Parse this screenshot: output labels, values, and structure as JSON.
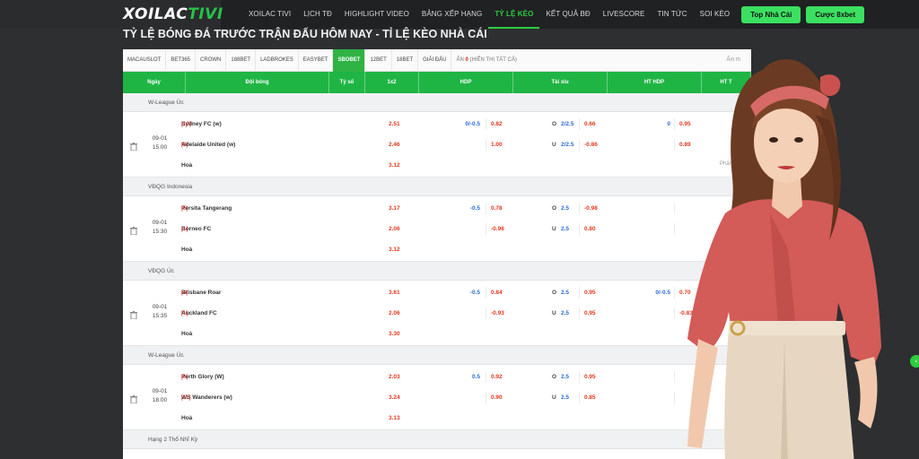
{
  "logo": {
    "part1": "XOILAC",
    "part2": "TIVI"
  },
  "nav": [
    "XOILAC TIVI",
    "LỊCH TĐ",
    "HIGHLIGHT VIDEO",
    "BẢNG XẾP HẠNG",
    "TỶ LỆ KÈO",
    "KẾT QUẢ BĐ",
    "LIVESCORE",
    "TIN TỨC",
    "SOI KÈO"
  ],
  "nav_active_index": 4,
  "cta": {
    "top": "Top Nhà Cái",
    "bet": "Cược 8xbet"
  },
  "page_title": "TỶ LỆ BÓNG ĐÁ TRƯỚC TRẬN ĐẤU HÔM NAY - TỈ LỆ KÈO NHÀ CÁI",
  "bookmakers": [
    "MACAUSLOT",
    "BET365",
    "CROWN",
    "188BET",
    "LADBROKES",
    "EASYBET",
    "SBOBET",
    "12BET",
    "18BET",
    "GIẢI ĐẤU"
  ],
  "bookmaker_active_index": 6,
  "hide": {
    "label": "ẨN",
    "count": "0",
    "show_all": "(HIỂN THỊ TẤT CẢ)",
    "right": "Ẩm th"
  },
  "columns": [
    "Ngày",
    "Đội bóng",
    "Tỷ số",
    "1x2",
    "HDP",
    "Tài xỉu",
    "HT HDP",
    "HT T"
  ],
  "more": "Phân tíc",
  "groups": [
    {
      "league": "W-League Úc",
      "date": "09-01",
      "time": "15:00",
      "home": "Sydney FC (w)",
      "home_rank": "[10]",
      "away": "Adelaide United (w)",
      "away_rank": "[8]",
      "draw": "Hoà",
      "x12": [
        "2.51",
        "2.46",
        "3.12"
      ],
      "hdp_line": [
        "0/-0.5",
        ""
      ],
      "hdp_odds": [
        "0.82",
        "1.00"
      ],
      "ou_side": [
        "O",
        "U"
      ],
      "ou_line": [
        "2/2.5",
        "2/2.5"
      ],
      "ou_odds": [
        "0.66",
        "-0.86"
      ],
      "ht_line": [
        "0",
        ""
      ],
      "ht_odds": [
        "0.95",
        "0.89"
      ],
      "show_more": true
    },
    {
      "league": "VĐQG Indonesia",
      "date": "09-01",
      "time": "15:30",
      "home": "Persita Tangerang",
      "home_rank": "[5]",
      "away": "Borneo FC",
      "away_rank": "[1]",
      "draw": "Hoà",
      "x12": [
        "3.17",
        "2.06",
        "3.12"
      ],
      "hdp_line": [
        "-0.5",
        ""
      ],
      "hdp_odds": [
        "0.78",
        "-0.96"
      ],
      "ou_side": [
        "O",
        "U"
      ],
      "ou_line": [
        "2.5",
        "2.5"
      ],
      "ou_odds": [
        "-0.98",
        "0.80"
      ],
      "ht_line": [
        "",
        ""
      ],
      "ht_odds": [
        "",
        ""
      ],
      "show_more": false
    },
    {
      "league": "VĐQG Úc",
      "date": "09-01",
      "time": "15:35",
      "home": "Brisbane Roar",
      "home_rank": "[4]",
      "away": "Auckland FC",
      "away_rank": "[1]",
      "draw": "Hoà",
      "x12": [
        "3.61",
        "2.06",
        "3.30"
      ],
      "hdp_line": [
        "-0.5",
        ""
      ],
      "hdp_odds": [
        "0.84",
        "-0.93"
      ],
      "ou_side": [
        "O",
        "U"
      ],
      "ou_line": [
        "2.5",
        "2.5"
      ],
      "ou_odds": [
        "0.95",
        "0.95"
      ],
      "ht_line": [
        "0/-0.5",
        ""
      ],
      "ht_odds": [
        "0.70",
        "-0.83"
      ],
      "show_more": false
    },
    {
      "league": "W-League Úc",
      "date": "09-01",
      "time": "18:00",
      "home": "Perth Glory (W)",
      "home_rank": "[6]",
      "away": "WS Wanderers (w)",
      "away_rank": "[11]",
      "draw": "Hoà",
      "x12": [
        "2.03",
        "3.24",
        "3.13"
      ],
      "hdp_line": [
        "0.5",
        ""
      ],
      "hdp_odds": [
        "0.92",
        "0.90"
      ],
      "ou_side": [
        "O",
        "U"
      ],
      "ou_line": [
        "2.5",
        "2.5"
      ],
      "ou_odds": [
        "0.95",
        "0.85"
      ],
      "ht_line": [
        "",
        ""
      ],
      "ht_odds": [
        "",
        ""
      ],
      "show_more": false
    }
  ],
  "next_league": "Hạng 2 Thổ Nhĩ Kỳ",
  "colors": {
    "brand_green": "#1fb544",
    "odds_red": "#e0391e",
    "line_blue": "#2a6bd4",
    "dark_bg": "#2d2f31"
  }
}
